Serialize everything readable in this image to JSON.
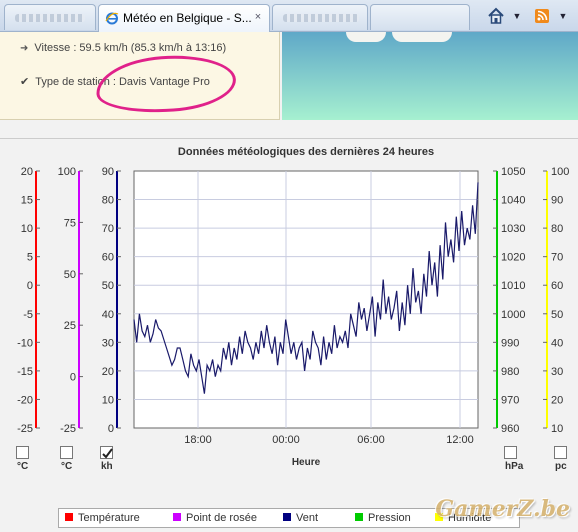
{
  "browser": {
    "active_tab_title": "Météo en Belgique - S...",
    "tab_close_label": "×"
  },
  "info": {
    "speed_text": "Vitesse : 59.5 km/h (85.3 km/h à 13:16)",
    "station_text": "Type de station : Davis Vantage Pro"
  },
  "chart_data": {
    "type": "line",
    "title": "Données météologiques des dernières 24 heures",
    "xlabel": "Heure",
    "x_ticks": [
      "18:00",
      "00:00",
      "06:00",
      "12:00"
    ],
    "left_axes": [
      {
        "name": "temperature",
        "color": "#ff0000",
        "unit": "°C",
        "ticks": [
          20,
          15,
          10,
          5,
          0,
          -5,
          -10,
          -15,
          -20,
          -25
        ]
      },
      {
        "name": "dew_point",
        "color": "#cc00ff",
        "unit": "°C",
        "ticks": [
          100,
          75,
          50,
          25,
          0,
          -25
        ]
      },
      {
        "name": "wind",
        "color": "#000080",
        "unit": "kh",
        "ticks": [
          90,
          80,
          70,
          60,
          50,
          40,
          30,
          20,
          10,
          0
        ]
      }
    ],
    "right_axes": [
      {
        "name": "pressure",
        "color": "#00cc00",
        "unit": "hPa",
        "ticks": [
          1050,
          1040,
          1030,
          1020,
          1010,
          1000,
          990,
          980,
          970,
          960
        ]
      },
      {
        "name": "humidity",
        "color": "#ffff00",
        "unit": "pc",
        "ticks": [
          100,
          90,
          80,
          70,
          60,
          50,
          40,
          30,
          20,
          10
        ]
      }
    ],
    "ylim": [
      0,
      90
    ],
    "series": [
      {
        "name": "Vent",
        "color": "#1a1a6a",
        "values": [
          38,
          30,
          40,
          34,
          32,
          36,
          30,
          33,
          38,
          35,
          34,
          31,
          28,
          25,
          22,
          24,
          28,
          28,
          24,
          20,
          18,
          26,
          22,
          20,
          24,
          18,
          12,
          22,
          20,
          24,
          18,
          22,
          20,
          28,
          24,
          30,
          22,
          28,
          24,
          32,
          26,
          34,
          30,
          28,
          24,
          30,
          26,
          34,
          28,
          36,
          30,
          26,
          32,
          22,
          30,
          26,
          38,
          32,
          26,
          30,
          24,
          28,
          30,
          20,
          28,
          24,
          34,
          30,
          28,
          22,
          32,
          24,
          30,
          26,
          36,
          28,
          32,
          30,
          34,
          28,
          40,
          36,
          32,
          44,
          38,
          42,
          34,
          40,
          46,
          32,
          44,
          38,
          52,
          40,
          46,
          38,
          42,
          48,
          34,
          44,
          36,
          50,
          40,
          56,
          44,
          48,
          40,
          54,
          46,
          62,
          50,
          58,
          46,
          64,
          52,
          72,
          60,
          66,
          58,
          74,
          62,
          76,
          64,
          70,
          66,
          78,
          68,
          86
        ]
      }
    ],
    "legend": [
      "Température",
      "Point de rosée",
      "Vent",
      "Pression",
      "Humidité"
    ],
    "legend_colors": [
      "#ff0000",
      "#cc00ff",
      "#000080",
      "#00cc00",
      "#ffff00"
    ]
  },
  "checkboxes": [
    {
      "label": "°C",
      "checked": false
    },
    {
      "label": "°C",
      "checked": false
    },
    {
      "label": "kh",
      "checked": true
    },
    {
      "label": "hPa",
      "checked": false
    },
    {
      "label": "pc",
      "checked": false
    }
  ],
  "watermark": "GamerZ.be"
}
